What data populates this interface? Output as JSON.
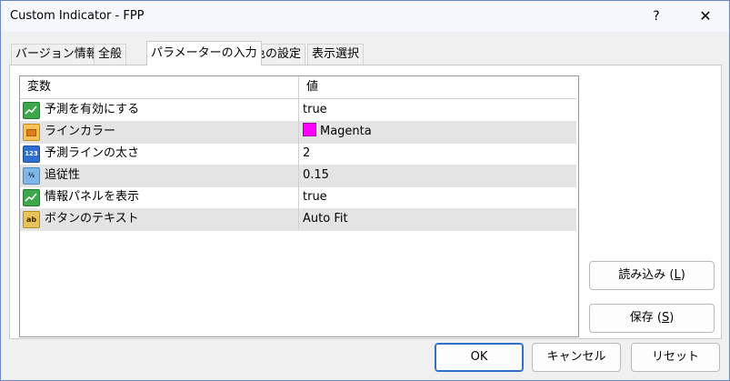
{
  "window": {
    "title": "Custom Indicator - FPP",
    "help": "?",
    "close": "✕"
  },
  "tabs": [
    "バージョン情報",
    "全般",
    "パラメーターの入力",
    "色の設定",
    "表示選択"
  ],
  "grid": {
    "headers": [
      "変数",
      "値"
    ],
    "rows": [
      {
        "name": "予測を有効にする",
        "value": "true",
        "icon": "bool-icon"
      },
      {
        "name": "ラインカラー",
        "value": "Magenta",
        "icon": "color-icon",
        "swatch": "#ff00ff"
      },
      {
        "name": "予測ラインの太さ",
        "value": "2",
        "icon": "int-icon",
        "icon_text": "123"
      },
      {
        "name": "追従性",
        "value": "0.15",
        "icon": "double-icon",
        "icon_text": "½"
      },
      {
        "name": "情報パネルを表示",
        "value": "true",
        "icon": "bool-icon"
      },
      {
        "name": "ボタンのテキスト",
        "value": "Auto Fit",
        "icon": "string-icon",
        "icon_text": "ab"
      }
    ]
  },
  "side_buttons": {
    "load": {
      "label": "読み込み (",
      "key": "L",
      "suffix": ")"
    },
    "save": {
      "label": "保存 (",
      "key": "S",
      "suffix": ")"
    }
  },
  "footer": {
    "ok": "OK",
    "cancel": "キャンセル",
    "reset": "リセット"
  }
}
